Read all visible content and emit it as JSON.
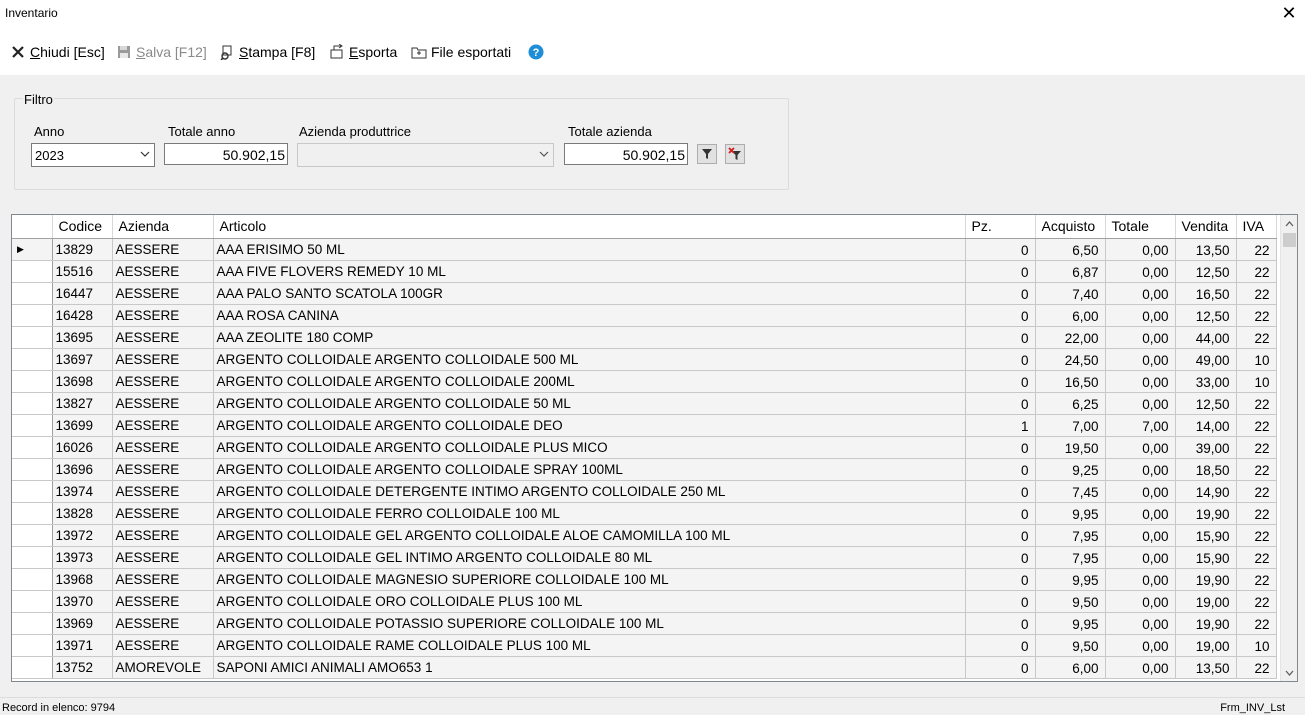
{
  "window": {
    "title": "Inventario"
  },
  "toolbar": {
    "close_label": "Chiudi [Esc]",
    "save_label": "Salva [F12]",
    "print_label": "Stampa [F8]",
    "export_label": "Esporta",
    "exported_files_label": "File esportati"
  },
  "filter": {
    "group_label": "Filtro",
    "year_label": "Anno",
    "year_value": "2023",
    "total_year_label": "Totale anno",
    "total_year_value": "50.902,15",
    "manufacturer_label": "Azienda produttrice",
    "manufacturer_value": "",
    "total_company_label": "Totale azienda",
    "total_company_value": "50.902,15"
  },
  "grid": {
    "columns": {
      "codice": "Codice",
      "azienda": "Azienda",
      "articolo": "Articolo",
      "pz": "Pz.",
      "acquisto": "Acquisto",
      "totale": "Totale",
      "vendita": "Vendita",
      "iva": "IVA"
    },
    "current_row_marker": "▶",
    "rows": [
      {
        "codice": "13829",
        "azienda": "AESSERE",
        "articolo": "AAA ERISIMO 50 ML",
        "pz": "0",
        "acquisto": "6,50",
        "totale": "0,00",
        "vendita": "13,50",
        "iva": "22"
      },
      {
        "codice": "15516",
        "azienda": "AESSERE",
        "articolo": "AAA FIVE FLOVERS REMEDY 10 ML",
        "pz": "0",
        "acquisto": "6,87",
        "totale": "0,00",
        "vendita": "12,50",
        "iva": "22"
      },
      {
        "codice": "16447",
        "azienda": "AESSERE",
        "articolo": "AAA PALO SANTO SCATOLA 100GR",
        "pz": "0",
        "acquisto": "7,40",
        "totale": "0,00",
        "vendita": "16,50",
        "iva": "22"
      },
      {
        "codice": "16428",
        "azienda": "AESSERE",
        "articolo": "AAA ROSA CANINA",
        "pz": "0",
        "acquisto": "6,00",
        "totale": "0,00",
        "vendita": "12,50",
        "iva": "22"
      },
      {
        "codice": "13695",
        "azienda": "AESSERE",
        "articolo": "AAA ZEOLITE 180 COMP",
        "pz": "0",
        "acquisto": "22,00",
        "totale": "0,00",
        "vendita": "44,00",
        "iva": "22"
      },
      {
        "codice": "13697",
        "azienda": "AESSERE",
        "articolo": "ARGENTO COLLOIDALE ARGENTO COLLOIDALE 500 ML",
        "pz": "0",
        "acquisto": "24,50",
        "totale": "0,00",
        "vendita": "49,00",
        "iva": "10"
      },
      {
        "codice": "13698",
        "azienda": "AESSERE",
        "articolo": "ARGENTO COLLOIDALE ARGENTO COLLOIDALE 200ML",
        "pz": "0",
        "acquisto": "16,50",
        "totale": "0,00",
        "vendita": "33,00",
        "iva": "10"
      },
      {
        "codice": "13827",
        "azienda": "AESSERE",
        "articolo": "ARGENTO COLLOIDALE ARGENTO COLLOIDALE 50 ML",
        "pz": "0",
        "acquisto": "6,25",
        "totale": "0,00",
        "vendita": "12,50",
        "iva": "22"
      },
      {
        "codice": "13699",
        "azienda": "AESSERE",
        "articolo": "ARGENTO COLLOIDALE ARGENTO COLLOIDALE  DEO",
        "pz": "1",
        "acquisto": "7,00",
        "totale": "7,00",
        "vendita": "14,00",
        "iva": "22"
      },
      {
        "codice": "16026",
        "azienda": "AESSERE",
        "articolo": "ARGENTO COLLOIDALE ARGENTO COLLOIDALE PLUS MICO",
        "pz": "0",
        "acquisto": "19,50",
        "totale": "0,00",
        "vendita": "39,00",
        "iva": "22"
      },
      {
        "codice": "13696",
        "azienda": "AESSERE",
        "articolo": "ARGENTO COLLOIDALE ARGENTO COLLOIDALE SPRAY 100ML",
        "pz": "0",
        "acquisto": "9,25",
        "totale": "0,00",
        "vendita": "18,50",
        "iva": "22"
      },
      {
        "codice": "13974",
        "azienda": "AESSERE",
        "articolo": "ARGENTO COLLOIDALE DETERGENTE INTIMO ARGENTO COLLOIDALE 250 ML",
        "pz": "0",
        "acquisto": "7,45",
        "totale": "0,00",
        "vendita": "14,90",
        "iva": "22"
      },
      {
        "codice": "13828",
        "azienda": "AESSERE",
        "articolo": "ARGENTO COLLOIDALE FERRO COLLOIDALE 100 ML",
        "pz": "0",
        "acquisto": "9,95",
        "totale": "0,00",
        "vendita": "19,90",
        "iva": "22"
      },
      {
        "codice": "13972",
        "azienda": "AESSERE",
        "articolo": "ARGENTO COLLOIDALE GEL ARGENTO COLLOIDALE ALOE CAMOMILLA 100 ML",
        "pz": "0",
        "acquisto": "7,95",
        "totale": "0,00",
        "vendita": "15,90",
        "iva": "22"
      },
      {
        "codice": "13973",
        "azienda": "AESSERE",
        "articolo": "ARGENTO COLLOIDALE GEL INTIMO ARGENTO COLLOIDALE 80 ML",
        "pz": "0",
        "acquisto": "7,95",
        "totale": "0,00",
        "vendita": "15,90",
        "iva": "22"
      },
      {
        "codice": "13968",
        "azienda": "AESSERE",
        "articolo": "ARGENTO COLLOIDALE MAGNESIO SUPERIORE COLLOIDALE 100 ML",
        "pz": "0",
        "acquisto": "9,95",
        "totale": "0,00",
        "vendita": "19,90",
        "iva": "22"
      },
      {
        "codice": "13970",
        "azienda": "AESSERE",
        "articolo": "ARGENTO COLLOIDALE ORO COLLOIDALE PLUS 100 ML",
        "pz": "0",
        "acquisto": "9,50",
        "totale": "0,00",
        "vendita": "19,00",
        "iva": "22"
      },
      {
        "codice": "13969",
        "azienda": "AESSERE",
        "articolo": "ARGENTO COLLOIDALE POTASSIO SUPERIORE COLLOIDALE 100 ML",
        "pz": "0",
        "acquisto": "9,95",
        "totale": "0,00",
        "vendita": "19,90",
        "iva": "22"
      },
      {
        "codice": "13971",
        "azienda": "AESSERE",
        "articolo": "ARGENTO COLLOIDALE RAME COLLOIDALE PLUS 100 ML",
        "pz": "0",
        "acquisto": "9,50",
        "totale": "0,00",
        "vendita": "19,00",
        "iva": "10"
      },
      {
        "codice": "13752",
        "azienda": "AMOREVOLE",
        "articolo": "SAPONI AMICI ANIMALI AMO653 1",
        "pz": "0",
        "acquisto": "6,00",
        "totale": "0,00",
        "vendita": "13,50",
        "iva": "22"
      }
    ]
  },
  "status": {
    "record_count": "Record in elenco: 9794",
    "form_name": "Frm_INV_Lst"
  },
  "icons": {
    "close": "close-icon",
    "save": "floppy-icon",
    "print": "print-icon",
    "export": "export-icon",
    "exported_files": "folder-icon",
    "help": "help-icon",
    "filter_apply": "filter-icon",
    "filter_clear": "filter-clear-icon"
  },
  "colors": {
    "help_accent": "#1e8fd6",
    "clear_filter_red": "#d21f1f"
  }
}
